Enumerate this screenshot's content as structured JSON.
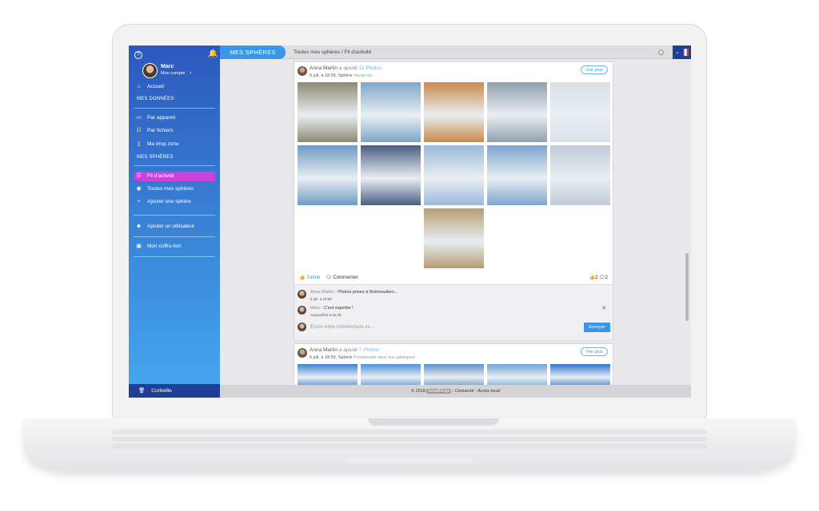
{
  "sidebar": {
    "user_name": "Marc",
    "account_label": "Mon compte",
    "items": [
      {
        "label": "Accueil",
        "icon": "home-icon"
      },
      {
        "label": "Par appareil",
        "icon": "device-icon"
      },
      {
        "label": "Par fichiers",
        "icon": "files-icon"
      },
      {
        "label": "Ma drop zone",
        "icon": "dropzone-icon"
      },
      {
        "label": "Fil d'activité",
        "icon": "list-icon"
      },
      {
        "label": "Toutes mes sphères",
        "icon": "globe-icon"
      },
      {
        "label": "Ajouter une sphère",
        "icon": "plus-icon"
      },
      {
        "label": "Ajouter un utilisateur",
        "icon": "add-user-icon"
      },
      {
        "label": "Mon coffre-fort",
        "icon": "lock-icon"
      }
    ],
    "section_data": "MES DONNÉES",
    "section_spheres": "MES SPHÈRES",
    "trash_label": "Corbeille"
  },
  "topbar": {
    "title": "MES SPHÈRES",
    "breadcrumb": "Toutes mes sphères / Fil d'activité"
  },
  "posts": [
    {
      "author": "Anna Martin",
      "action": "a ajouté",
      "count_label": "11 Photos",
      "date": "6 juil. à 18:59, Sphère",
      "sphere": "Vacances",
      "more": "Voir plus",
      "like": "J'aime",
      "comment": "Commenter",
      "likes": "2",
      "comments_count": "2",
      "photos": [
        "#8d8a74",
        "#7fa6c9",
        "#c98a4c",
        "#8fa0ae",
        "#d8e0e8",
        "#6f9bc4",
        "#4a5e82",
        "#9ab9d9",
        "#7ea4cf",
        "#c0ccd8",
        "#b79c73"
      ]
    },
    {
      "author": "Anna Martin",
      "action": "a ajouté",
      "count_label": "7 Photos",
      "date": "6 juil. à 18:59, Sphère",
      "sphere": "Promenade dans les calanques",
      "more": "Voir plus",
      "photos": [
        "#3b82d0",
        "#4a93dc",
        "#5d90c8",
        "#6da4d8",
        "#2f77cc"
      ]
    }
  ],
  "comments": [
    {
      "who": "Anna Martin",
      "text": "Photos prises à Noirmoutiers...",
      "date": "6 juil. à 18:59"
    },
    {
      "who": "Marc",
      "text": "C'est superbe !",
      "date": "Aujourd'hui à 15:48"
    }
  ],
  "comment_input": {
    "placeholder": "Ecrire votre commentaire ici...",
    "send": "Envoyer"
  },
  "footer": {
    "copy": "© 2018",
    "brand": "novathings",
    "status": "- Connecté - Accès local"
  },
  "accent": "#3a96e6",
  "active_color": "#cc42d8"
}
